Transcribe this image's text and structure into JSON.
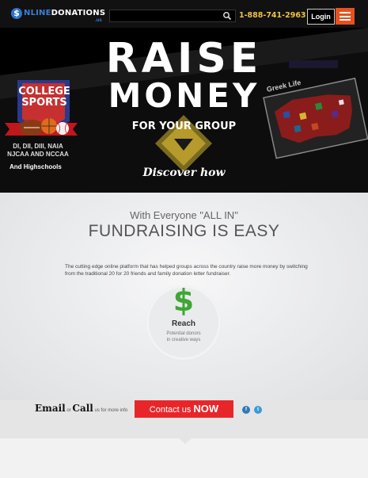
{
  "header": {
    "logo_mark": "$",
    "logo_prefix": "NLINE",
    "logo_suffix": "DONATIONS",
    "logo_tld": ".us",
    "search_placeholder": "",
    "phone": "1-888-741-2963",
    "login_label": "Login"
  },
  "hero": {
    "title_line1": "RAISE",
    "title_line2": "MONEY",
    "subtitle": "FOR YOUR GROUP",
    "cta": "Discover how",
    "college_line1": "COLLEGE",
    "college_line2": "SPORTS",
    "divisions_line1": "DI, DII, DIII, NAIA",
    "divisions_line2": "NJCAA AND NCCAA",
    "highschools": "And Highschools",
    "greek": "Greek Life"
  },
  "intro": {
    "heading_small": "With Everyone \"ALL IN\"",
    "heading_large": "FUNDRAISING IS EASY",
    "description": "The cutting edge online platform that has helped groups across the country raise more money by switching from the traditional 20 for 20 friends and family donation letter fundraiser."
  },
  "feature": {
    "icon": "dollar-icon",
    "icon_glyph": "$",
    "title": "Reach",
    "subtitle_line1": "Potential donors",
    "subtitle_line2": "in creative ways"
  },
  "contact": {
    "email": "Email",
    "or": " or ",
    "call": "Call",
    "more": " us for more info",
    "button_prefix": "Contact us ",
    "button_emphasis": "NOW",
    "social1": "f",
    "social2": "t"
  },
  "colors": {
    "accent": "#e8501e",
    "phone": "#f0c040",
    "cta_red": "#e8262a",
    "dollar_green": "#3fa635"
  }
}
